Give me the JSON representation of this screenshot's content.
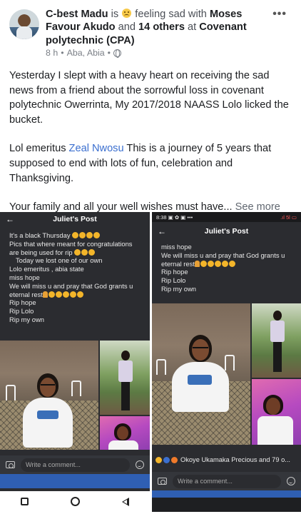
{
  "post": {
    "author": "C-best Madu",
    "is_text": " is ",
    "feeling": " feeling sad with ",
    "tagged": "Moses Favour Akudo",
    "and_text": " and ",
    "others": "14 others",
    "at_text": " at ",
    "location_tag": "Covenant polytechnic (CPA)",
    "time": "8 h",
    "place": "Aba, Abia",
    "separator": "•",
    "body_para1": "Yesterday I slept with a heavy heart on receiving the sad news from a friend about the sorrowful loss in covenant polytechnic Owerrinta, My 2017/2018 NAASS Lolo licked the bucket.",
    "body_para2_a": "Lol emeritus ",
    "body_para2_link": "Zeal Nwosu",
    "body_para2_b": " This is a journey of 5 years that supposed to end with lots of fun, celebration and Thanksgiving.",
    "body_para3": "Your family and all your well wishes must have... ",
    "see_more": "See more",
    "more_icon": "•••"
  },
  "left_screenshot": {
    "title": "Juliet's Post",
    "back_icon": "←",
    "lines": [
      "It's a black Thursday",
      "Pics that where meant for congratulations",
      "are being used for rip",
      "Today we lost one of our own",
      "Lolo emeritus , abia state",
      "miss hope",
      "We will miss u and pray that God grants u",
      "eternal rest",
      "Rip  hope",
      "Rip Lolo",
      "Rip my own"
    ],
    "comment_placeholder": "Write a comment..."
  },
  "right_screenshot": {
    "status_time": "8:38",
    "status_icons": "▣ ✿ ▣ •••",
    "status_right": ".ıl 5l ▭",
    "title": "Juliet's Post",
    "back_icon": "←",
    "lines": [
      "miss hope",
      "We will miss u and pray that God grants u",
      "eternal rest",
      "Rip  hope",
      "Rip Lolo",
      "Rip my own"
    ],
    "reactions": "Okoye Ukamaka Precious and 79 o...",
    "comment_placeholder": "Write a comment..."
  },
  "colors": {
    "link": "#3b6fcf",
    "panel_bg": "#2b2c30",
    "fb_blue": "#2f5fb3"
  }
}
